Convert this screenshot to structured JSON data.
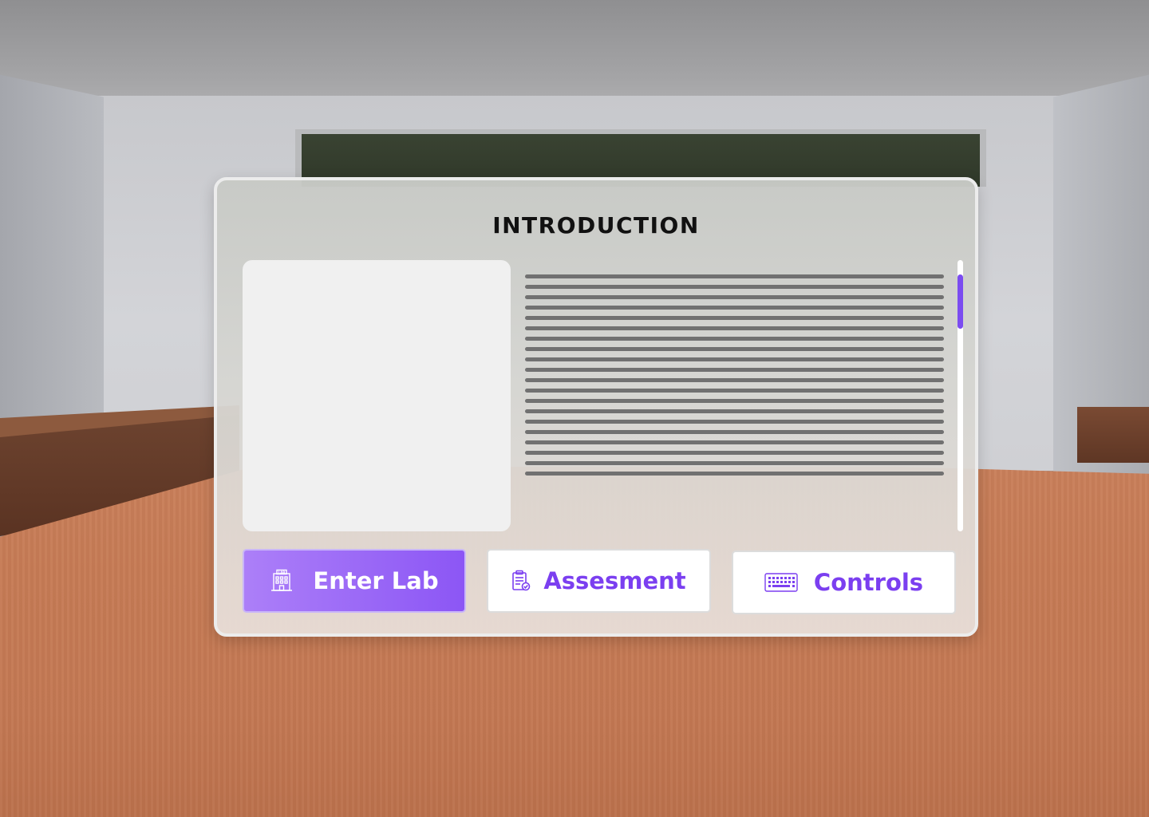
{
  "panel": {
    "title": "INTRODUCTION"
  },
  "buttons": {
    "enter_lab": {
      "label": "Enter Lab",
      "icon": "lab-building-icon"
    },
    "assessment": {
      "label": "Assesment",
      "icon": "clipboard-check-icon"
    },
    "controls": {
      "label": "Controls",
      "icon": "keyboard-icon"
    }
  },
  "colors": {
    "accent": "#7b3ff0",
    "primary_button_start": "#ac7ff8",
    "primary_button_end": "#8c56f5",
    "scroll_thumb": "#7b4cf0"
  }
}
